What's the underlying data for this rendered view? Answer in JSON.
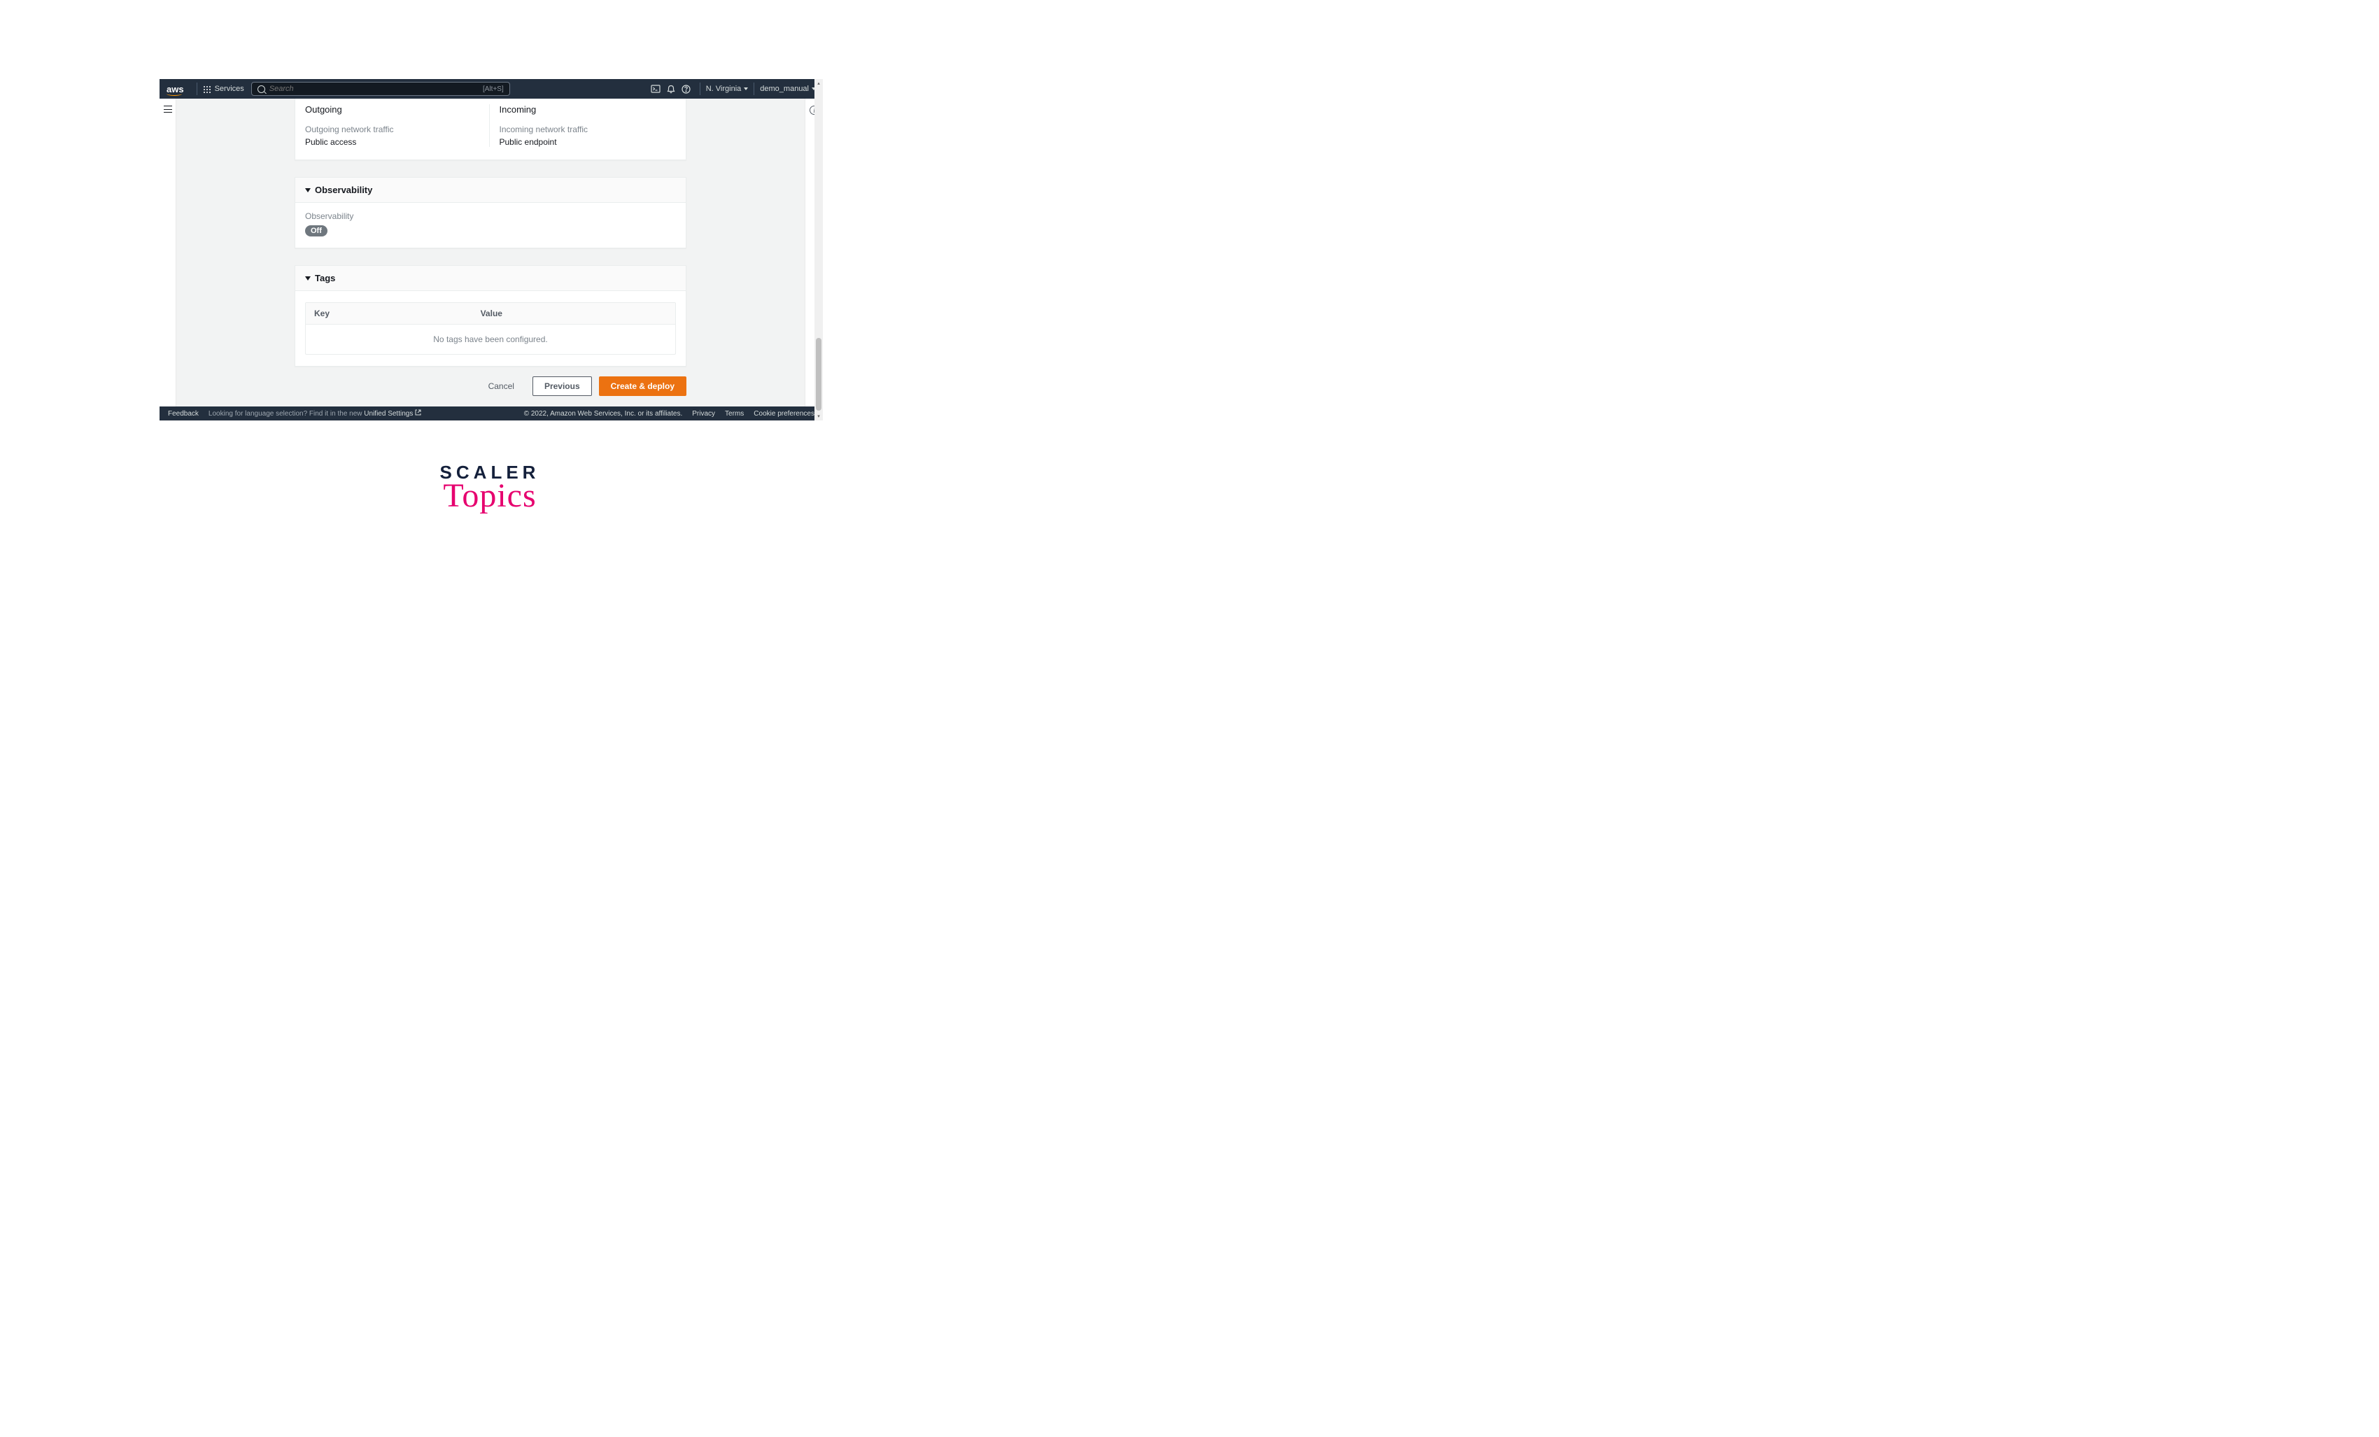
{
  "topnav": {
    "logo": "aws",
    "services_label": "Services",
    "search_placeholder": "Search",
    "search_kbd": "[Alt+S]",
    "region": "N. Virginia",
    "account": "demo_manual"
  },
  "networking": {
    "outgoing": {
      "heading": "Outgoing",
      "sub": "Outgoing network traffic",
      "value": "Public access"
    },
    "incoming": {
      "heading": "Incoming",
      "sub": "Incoming network traffic",
      "value": "Public endpoint"
    }
  },
  "observability": {
    "title": "Observability",
    "label": "Observability",
    "status": "Off"
  },
  "tags": {
    "title": "Tags",
    "columns": {
      "key": "Key",
      "value": "Value"
    },
    "empty": "No tags have been configured."
  },
  "actions": {
    "cancel": "Cancel",
    "previous": "Previous",
    "create": "Create & deploy"
  },
  "footer": {
    "feedback": "Feedback",
    "lang_hint_pre": "Looking for language selection? Find it in the new ",
    "lang_hint_link": "Unified Settings",
    "copyright": "© 2022, Amazon Web Services, Inc. or its affiliates.",
    "privacy": "Privacy",
    "terms": "Terms",
    "cookies": "Cookie preferences"
  },
  "watermark": {
    "line1": "SCALER",
    "line2": "Topics"
  }
}
